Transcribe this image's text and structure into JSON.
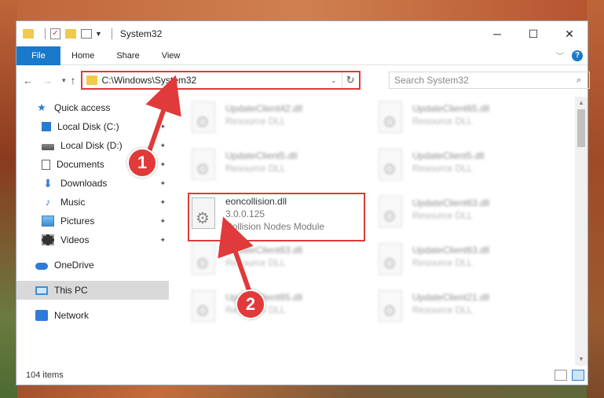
{
  "window": {
    "title": "System32",
    "minimize": "─",
    "maximize": "☐",
    "close": "✕"
  },
  "ribbon": {
    "file": "File",
    "tabs": [
      "Home",
      "Share",
      "View"
    ],
    "help": "?"
  },
  "address": {
    "path": "C:\\Windows\\System32",
    "refresh": "↻"
  },
  "search": {
    "placeholder": "Search System32"
  },
  "sidebar": {
    "items": [
      {
        "label": "Quick access"
      },
      {
        "label": "Local Disk (C:)"
      },
      {
        "label": "Local Disk (D:)"
      },
      {
        "label": "Documents"
      },
      {
        "label": "Downloads"
      },
      {
        "label": "Music"
      },
      {
        "label": "Pictures"
      },
      {
        "label": "Videos"
      },
      {
        "label": "OneDrive"
      },
      {
        "label": "This PC"
      },
      {
        "label": "Network"
      }
    ]
  },
  "files": [
    {
      "name": "UpdateClient42.dll",
      "desc": "Resource DLL"
    },
    {
      "name": "UpdateClient65.dll",
      "desc": "Resource DLL"
    },
    {
      "name": "UpdateClient5.dll",
      "desc": "Resource DLL"
    },
    {
      "name": "UpdateClient5.dll",
      "desc": "Resource DLL"
    },
    {
      "name": "eoncollision.dll",
      "version": "3.0.0.125",
      "desc": "Collision Nodes Module"
    },
    {
      "name": "UpdateClient63.dll",
      "desc": "Resource DLL"
    },
    {
      "name": "UpdateClient63.dll",
      "desc": "Resource DLL"
    },
    {
      "name": "UpdateClient63.dll",
      "desc": "Resource DLL"
    },
    {
      "name": "UpdateClient65.dll",
      "desc": "Resource DLL"
    },
    {
      "name": "UpdateClient21.dll",
      "desc": "Resource DLL"
    }
  ],
  "status": {
    "count": "104 items"
  },
  "callouts": {
    "one": "1",
    "two": "2"
  },
  "colors": {
    "accent": "#1979ca",
    "highlight": "#e03a3a"
  }
}
